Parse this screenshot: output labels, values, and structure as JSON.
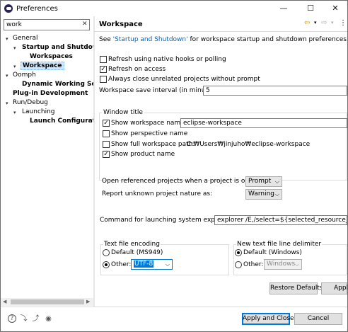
{
  "window": {
    "title": "Preferences",
    "minimize_glyph": "—",
    "maximize_glyph": "☐",
    "close_glyph": "✕"
  },
  "filter": {
    "value": "work",
    "clear_glyph": "✕"
  },
  "tree": [
    {
      "label": "General",
      "expanded": true
    },
    {
      "label": "Startup and Shutdown",
      "expanded": true
    },
    {
      "label": "Workspaces"
    },
    {
      "label": "Workspace",
      "selected": true
    },
    {
      "label": "Oomph",
      "expanded": true
    },
    {
      "label": "Dynamic Working Sets"
    },
    {
      "label": "Plug-in Development"
    },
    {
      "label": "Run/Debug",
      "expanded": true
    },
    {
      "label": "Launching",
      "expanded": true
    },
    {
      "label": "Launch Configuration"
    }
  ],
  "page": {
    "title": "Workspace",
    "nav_back": "⇦",
    "nav_forward": "⇨",
    "menu_glyph": "⋮",
    "intro_prefix": "See ",
    "intro_link": "'Startup and Shutdown'",
    "intro_suffix": " for workspace startup and shutdown preferences.",
    "refresh_native": {
      "label": "Refresh using native hooks or polling",
      "checked": false
    },
    "refresh_access": {
      "label": "Refresh on access",
      "checked": true
    },
    "always_close": {
      "label": "Always close unrelated projects without prompt",
      "checked": false
    },
    "save_interval_label": "Workspace save interval (in minutes):",
    "save_interval_value": "5",
    "window_title_group": "Window title",
    "show_ws_name": {
      "label": "Show workspace name:",
      "checked": true
    },
    "ws_name_value": "eclipse-workspace",
    "show_perspective": {
      "label": "Show perspective name",
      "checked": false
    },
    "show_full_path": {
      "label": "Show full workspace path:",
      "checked": false
    },
    "full_path_value": "C:₩Users₩jinjuho₩eclipse-workspace",
    "show_product": {
      "label": "Show product name",
      "checked": true
    },
    "open_ref_label": "Open referenced projects when a project is opened:",
    "open_ref_value": "Prompt",
    "report_unknown_label": "Report unknown project nature as:",
    "report_unknown_value": "Warning",
    "explorer_label": "Command for launching system explorer:",
    "explorer_value": "explorer /E,/select=${selected_resource_loc}",
    "encoding_group": "Text file encoding",
    "encoding_default": "Default (MS949)",
    "encoding_other": "Other:",
    "encoding_other_value": "UTF-8",
    "delimiter_group": "New text file line delimiter",
    "delimiter_default": "Default (Windows)",
    "delimiter_other": "Other:",
    "delimiter_other_value": "Windows",
    "restore_defaults": "Restore Defaults",
    "apply": "Apply"
  },
  "footer": {
    "apply_close": "Apply and Close",
    "cancel": "Cancel"
  },
  "icons": [
    "help-icon",
    "import-icon",
    "export-icon",
    "oomph-icon"
  ]
}
